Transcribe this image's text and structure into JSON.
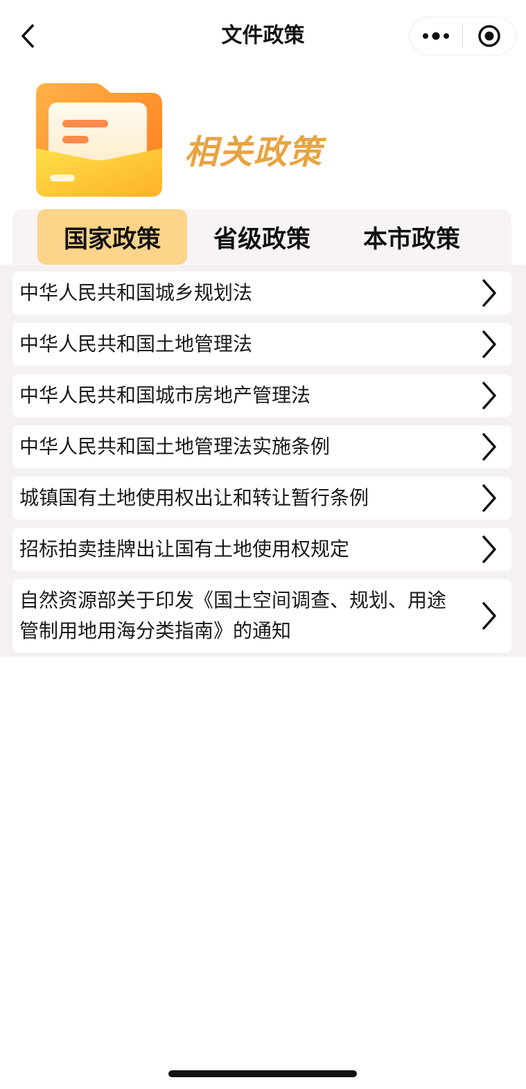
{
  "nav": {
    "title": "文件政策",
    "back_icon": "chevron-left-icon",
    "more_icon": "more-dots-icon",
    "close_icon": "target-circle-icon"
  },
  "banner": {
    "title": "相关政策",
    "icon": "folder-icon",
    "accent_color": "#e8a341"
  },
  "tabs": [
    {
      "label": "国家政策",
      "active": true
    },
    {
      "label": "省级政策",
      "active": false
    },
    {
      "label": "本市政策",
      "active": false
    }
  ],
  "tab_active_color": "#fcd48a",
  "policies": [
    {
      "title": "中华人民共和国城乡规划法"
    },
    {
      "title": "中华人民共和国土地管理法"
    },
    {
      "title": "中华人民共和国城市房地产管理法"
    },
    {
      "title": "中华人民共和国土地管理法实施条例"
    },
    {
      "title": "城镇国有土地使用权出让和转让暂行条例"
    },
    {
      "title": "招标拍卖挂牌出让国有土地使用权规定"
    },
    {
      "title": "自然资源部关于印发《国土空间调查、规划、用途管制用地用海分类指南》的通知"
    }
  ]
}
